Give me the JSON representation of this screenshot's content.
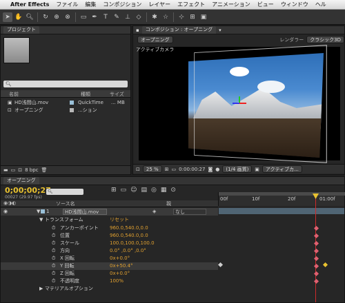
{
  "menubar": {
    "apple": "",
    "app": "After Effects",
    "items": [
      "ファイル",
      "編集",
      "コンポジション",
      "レイヤー",
      "エフェクト",
      "アニメーション",
      "ビュー",
      "ウィンドウ",
      "ヘル"
    ]
  },
  "project": {
    "tab": "プロジェクト",
    "search_placeholder": "",
    "columns": {
      "name": "名前",
      "type": "種類",
      "size": "サイズ"
    },
    "items": [
      {
        "name": "HD浅間山.mov",
        "type": "QuickTime",
        "size": "... MB",
        "color": "#9ac0d8"
      },
      {
        "name": "オープニング",
        "type": "...ション",
        "size": "",
        "color": "#b8b8b8"
      }
    ],
    "bpc": "8 bpc"
  },
  "composition": {
    "tab": "コンポジション : オープニング",
    "comp_button": "オープニング",
    "renderer_label": "レンダラー",
    "renderer_value": "クラシック3D",
    "camera_label": "アクティブカメラ",
    "zoom": "25 %",
    "timecode": "0:00:00:27",
    "resolution": "(1/4 画質)",
    "view": "アクティブカ..."
  },
  "timeline": {
    "tab": "オープニング",
    "timecode": "0;00;00;27",
    "fps": "00027 (29.97 fps)",
    "search_placeholder": "",
    "source_header": "ソース名",
    "parent_header": "親",
    "ruler": [
      "00f",
      "10f",
      "20f",
      "01:00f"
    ],
    "layer": {
      "num": "1",
      "name": "HD浅間山.mov",
      "parent": "なし"
    },
    "transform": {
      "label": "トランスフォーム",
      "reset": "リセット"
    },
    "props": [
      {
        "name": "アンカーポイント",
        "value": "960.0,540.0,0.0"
      },
      {
        "name": "位置",
        "value": "960.0,540.0,0.0"
      },
      {
        "name": "スケール",
        "value": "100.0,100.0,100.0"
      },
      {
        "name": "方向",
        "value": "0.0° ,0.0° ,0.0°"
      },
      {
        "name": "X 回転",
        "value": "0x+0.0°"
      },
      {
        "name": "Y 回転",
        "value": "0x+50.4°"
      },
      {
        "name": "Z 回転",
        "value": "0x+0.0°"
      },
      {
        "name": "不透明度",
        "value": "100%"
      }
    ],
    "material": "マテリアルオプション"
  }
}
